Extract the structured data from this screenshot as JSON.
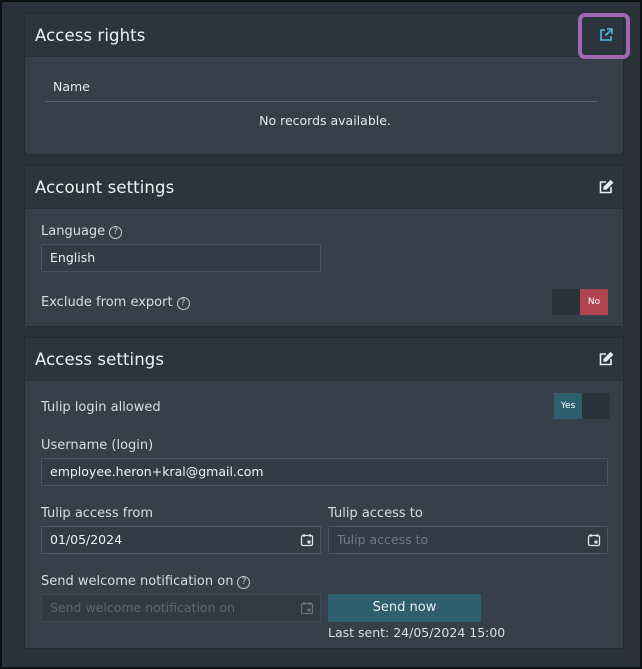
{
  "access_rights": {
    "title": "Access rights",
    "column_name": "Name",
    "empty_message": "No records available."
  },
  "account_settings": {
    "title": "Account settings",
    "language_label": "Language",
    "language_value": "English",
    "exclude_label": "Exclude from export",
    "exclude_toggle_label": "No"
  },
  "access_settings": {
    "title": "Access settings",
    "login_allowed_label": "Tulip login allowed",
    "login_toggle_label": "Yes",
    "username_label": "Username (login)",
    "username_value": "employee.heron+kral@gmail.com",
    "access_from_label": "Tulip access from",
    "access_from_value": "01/05/2024",
    "access_to_label": "Tulip access to",
    "access_to_placeholder": "Tulip access to",
    "welcome_label": "Send welcome notification on",
    "welcome_placeholder": "Send welcome notification on",
    "send_now_label": "Send now",
    "last_sent": "Last sent: 24/05/2024 15:00"
  },
  "icons": {
    "external_link": "external-link-icon",
    "edit": "edit-icon",
    "calendar": "calendar-icon",
    "help": "help-icon"
  },
  "colors": {
    "toggle_no": "#b0444f",
    "toggle_yes": "#2e5f6f",
    "highlight": "#a067b2"
  }
}
